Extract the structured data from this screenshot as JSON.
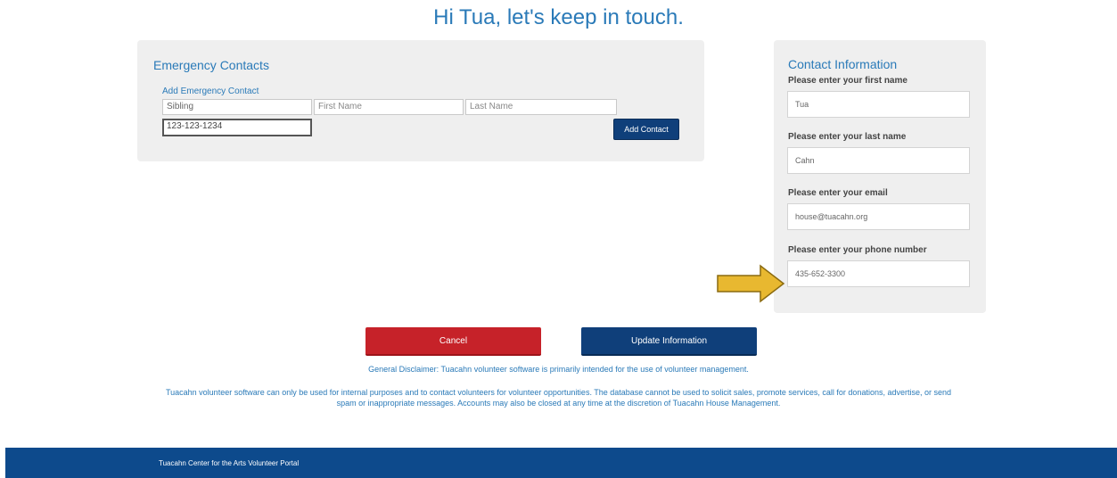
{
  "greeting": "Hi Tua, let's keep in touch.",
  "emergency": {
    "title": "Emergency Contacts",
    "add_link": "Add Emergency Contact",
    "relationship_value": "Sibling",
    "first_name_placeholder": "First Name",
    "last_name_placeholder": "Last Name",
    "phone_value": "123-123-1234",
    "add_button": "Add Contact"
  },
  "contact": {
    "title": "Contact Information",
    "first_name_label": "Please enter your first name",
    "first_name_value": "Tua",
    "last_name_label": "Please enter your last name",
    "last_name_value": "Cahn",
    "email_label": "Please enter your email",
    "email_value": "house@tuacahn.org",
    "phone_label": "Please enter your phone number",
    "phone_value": "435-652-3300"
  },
  "actions": {
    "cancel": "Cancel",
    "update": "Update Information"
  },
  "disclaimer": {
    "general": "General Disclaimer: Tuacahn volunteer software is primarily intended for the use of volunteer management.",
    "usage": "Tuacahn volunteer software can only be used for internal purposes and to contact volunteers for volunteer opportunities. The database cannot be used to solicit sales, promote services, call for donations, advertise, or send spam or inappropriate messages. Accounts may also be closed at any time at the discretion of Tuacahn House Management."
  },
  "footer": {
    "text": "Tuacahn Center for the Arts Volunteer Portal",
    "color": "#0d4a8c"
  },
  "colors": {
    "accent": "#2a7ab8",
    "primary_button": "#0f3f7a",
    "cancel_button": "#c62229",
    "arrow": "#e8b830"
  }
}
